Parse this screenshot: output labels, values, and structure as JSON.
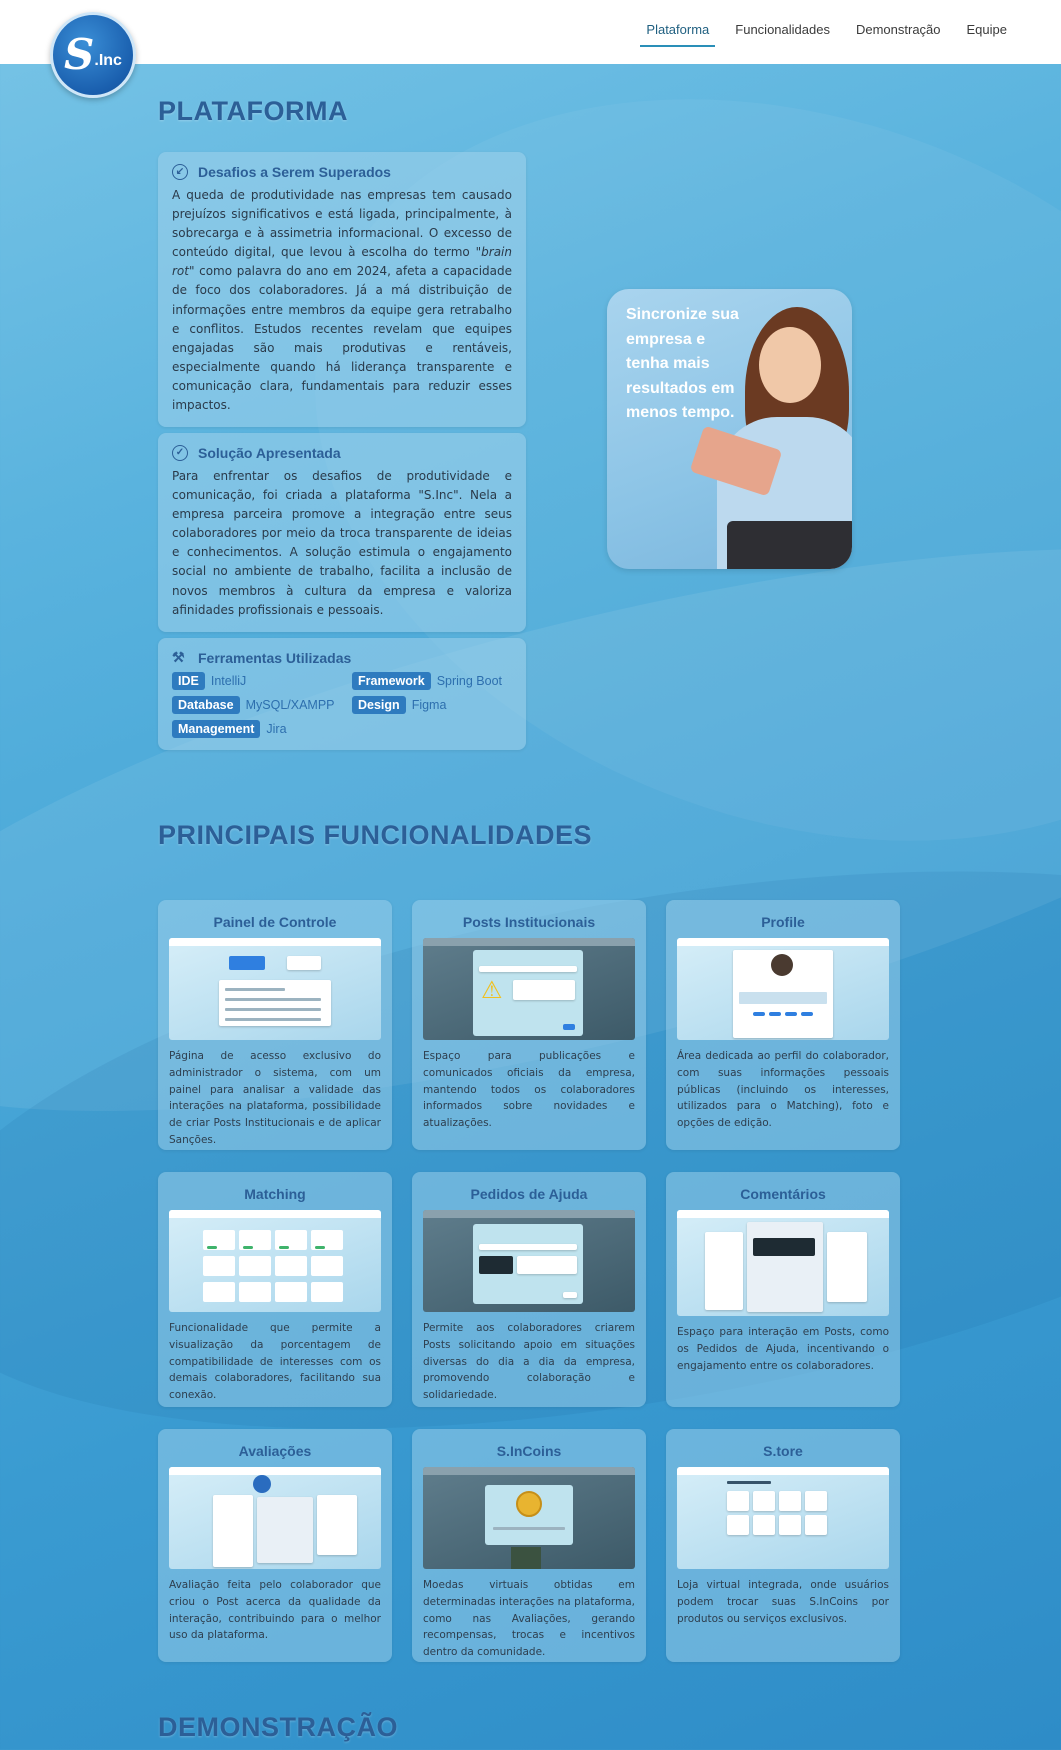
{
  "logo": {
    "mark": "S",
    "text": ".Inc"
  },
  "nav": {
    "items": [
      {
        "label": "Plataforma",
        "active": true
      },
      {
        "label": "Funcionalidades",
        "active": false
      },
      {
        "label": "Demonstração",
        "active": false
      },
      {
        "label": "Equipe",
        "active": false
      }
    ]
  },
  "sections": {
    "plataforma": "PLATAFORMA",
    "funcionalidades": "PRINCIPAIS FUNCIONALIDADES",
    "demonstracao": "DEMONSTRAÇÃO"
  },
  "desafios": {
    "title": "Desafios a Serem Superados",
    "text_part1": "A queda de produtividade nas empresas tem causado prejuízos significativos e está ligada, principalmente, à sobrecarga e à assimetria informacional. O excesso de conteúdo digital, que levou à escolha do termo ",
    "text_emphasis": "\"brain rot\"",
    "text_part2": " como palavra do ano em 2024, afeta a capacidade de foco dos colaboradores. Já a má distribuição de informações entre membros da equipe gera retrabalho e conflitos. Estudos recentes revelam que equipes engajadas são mais produtivas e rentáveis, especialmente quando há liderança transparente e comunicação clara, fundamentais para reduzir esses impactos."
  },
  "solucao": {
    "title": "Solução Apresentada",
    "text": "Para enfrentar os desafios de produtividade e comunicação, foi criada a plataforma \"S.Inc\". Nela a empresa parceira promove a integração entre seus colaboradores por meio da troca transparente de ideias e conhecimentos. A solução estimula o engajamento social no ambiente de trabalho, facilita a inclusão de novos membros à cultura da empresa e valoriza afinidades profissionais e pessoais."
  },
  "ferramentas": {
    "title": "Ferramentas Utilizadas",
    "items": [
      {
        "tag": "IDE",
        "value": "IntelliJ"
      },
      {
        "tag": "Framework",
        "value": "Spring Boot"
      },
      {
        "tag": "Database",
        "value": "MySQL/XAMPP"
      },
      {
        "tag": "Design",
        "value": "Figma"
      },
      {
        "tag": "Management",
        "value": "Jira"
      }
    ]
  },
  "promo": {
    "text": "Sincronize sua empresa e tenha mais resultados em menos tempo."
  },
  "features": [
    {
      "title": "Painel de Controle",
      "text": "Página de acesso exclusivo do administrador o sistema, com um painel para analisar a validade das interações na plataforma, possibilidade de criar Posts Institucionais e de aplicar Sanções."
    },
    {
      "title": "Posts Institucionais",
      "text": "Espaço para publicações e comunicados oficiais da empresa, mantendo todos os colaboradores informados sobre novidades e atualizações."
    },
    {
      "title": "Profile",
      "text": "Área dedicada ao perfil do colaborador, com suas informações pessoais públicas (incluindo os interesses, utilizados para o Matching), foto e opções de edição."
    },
    {
      "title": "Matching",
      "text": "Funcionalidade que permite a visualização da porcentagem de compatibilidade de interesses com os demais colaboradores, facilitando sua conexão."
    },
    {
      "title": "Pedidos de Ajuda",
      "text": "Permite aos colaboradores criarem Posts solicitando apoio em situações diversas do dia a dia da empresa, promovendo colaboração e solidariedade."
    },
    {
      "title": "Comentários",
      "text": "Espaço para interação em Posts, como os Pedidos de Ajuda, incentivando o engajamento entre os colaboradores."
    },
    {
      "title": "Avaliações",
      "text": "Avaliação feita pelo colaborador que criou o Post acerca da qualidade da interação, contribuindo para o melhor uso da plataforma."
    },
    {
      "title": "S.InCoins",
      "text": "Moedas virtuais obtidas em determinadas interações na plataforma, como nas Avaliações, gerando recompensas, trocas e incentivos dentro da comunidade."
    },
    {
      "title": "S.tore",
      "text": "Loja virtual integrada, onde usuários podem trocar suas S.InCoins por produtos ou serviços exclusivos."
    }
  ]
}
